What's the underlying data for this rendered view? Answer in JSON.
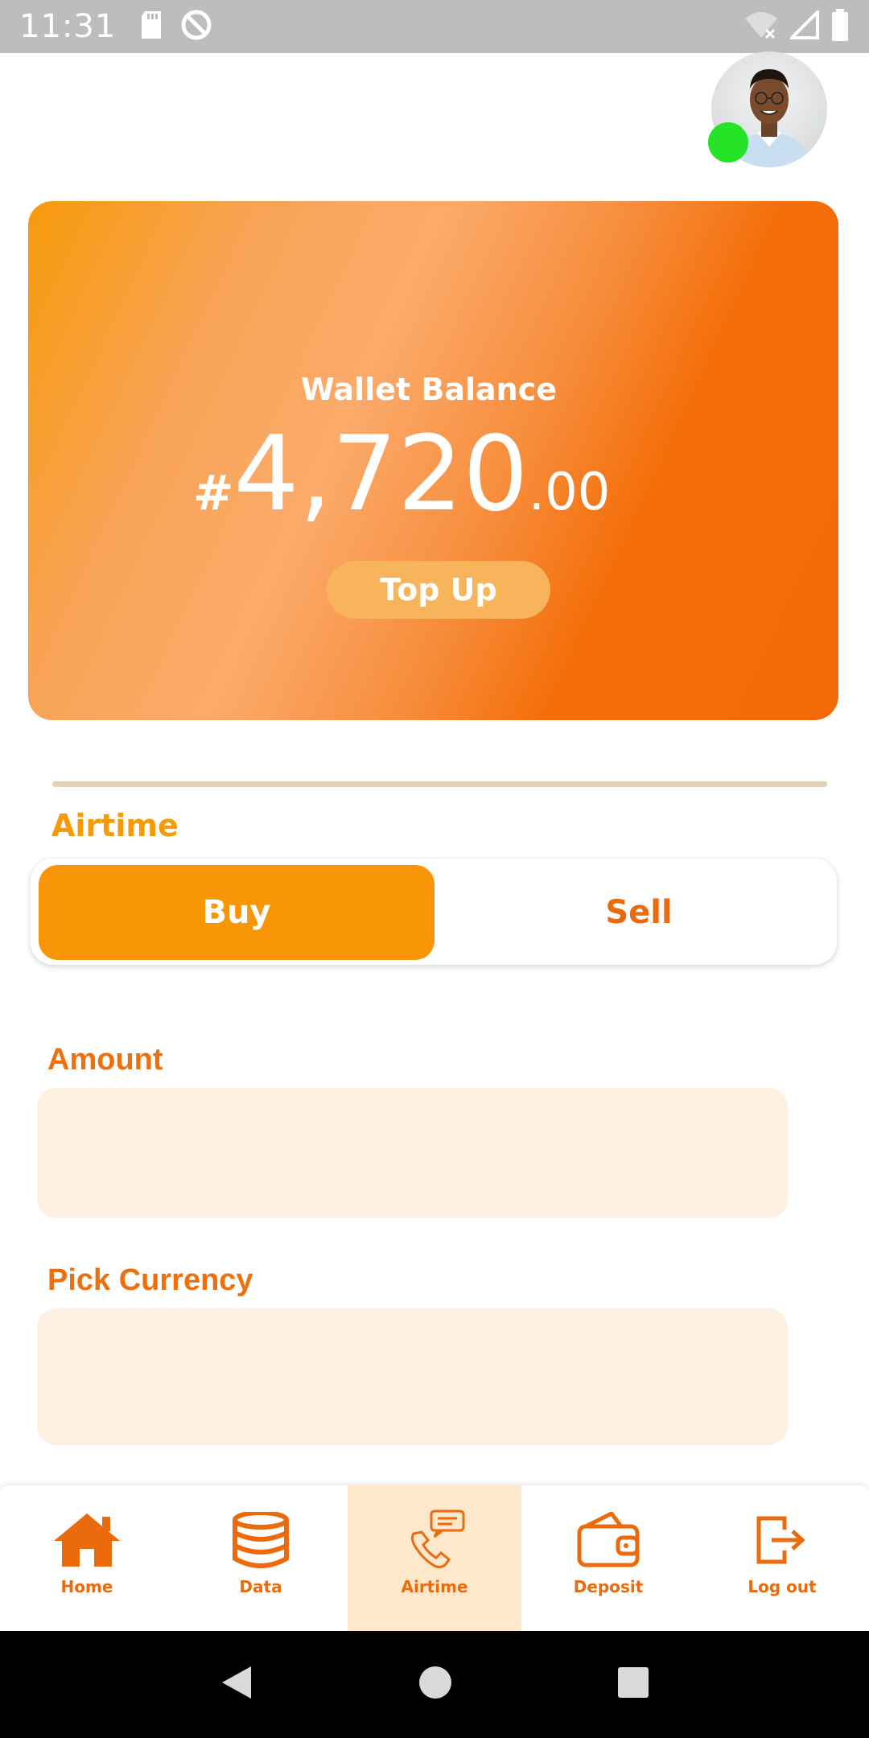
{
  "status_bar": {
    "time": "11:31"
  },
  "profile": {
    "online": true,
    "status_color": "#27e327"
  },
  "wallet": {
    "title": "Wallet Balance",
    "currency_symbol": "#",
    "amount_main": "4,720",
    "amount_decimal": ".00",
    "top_up_label": "Top Up"
  },
  "airtime": {
    "section_title": "Airtime",
    "tabs": [
      {
        "label": "Buy",
        "selected": true
      },
      {
        "label": "Sell",
        "selected": false
      }
    ]
  },
  "form": {
    "amount_label": "Amount",
    "amount_value": "",
    "currency_label": "Pick Currency",
    "currency_value": ""
  },
  "bottom_nav": {
    "items": [
      {
        "label": "Home",
        "icon": "home-icon",
        "active": false
      },
      {
        "label": "Data",
        "icon": "database-icon",
        "active": false
      },
      {
        "label": "Airtime",
        "icon": "phone-message-icon",
        "active": true
      },
      {
        "label": "Deposit",
        "icon": "wallet-icon",
        "active": false
      },
      {
        "label": "Log out",
        "icon": "logout-icon",
        "active": false
      }
    ]
  },
  "colors": {
    "accent_orange": "#f99607",
    "label_orange": "#ee6f0c",
    "field_background": "#fef0e0",
    "active_nav_background": "#fde8cc"
  }
}
